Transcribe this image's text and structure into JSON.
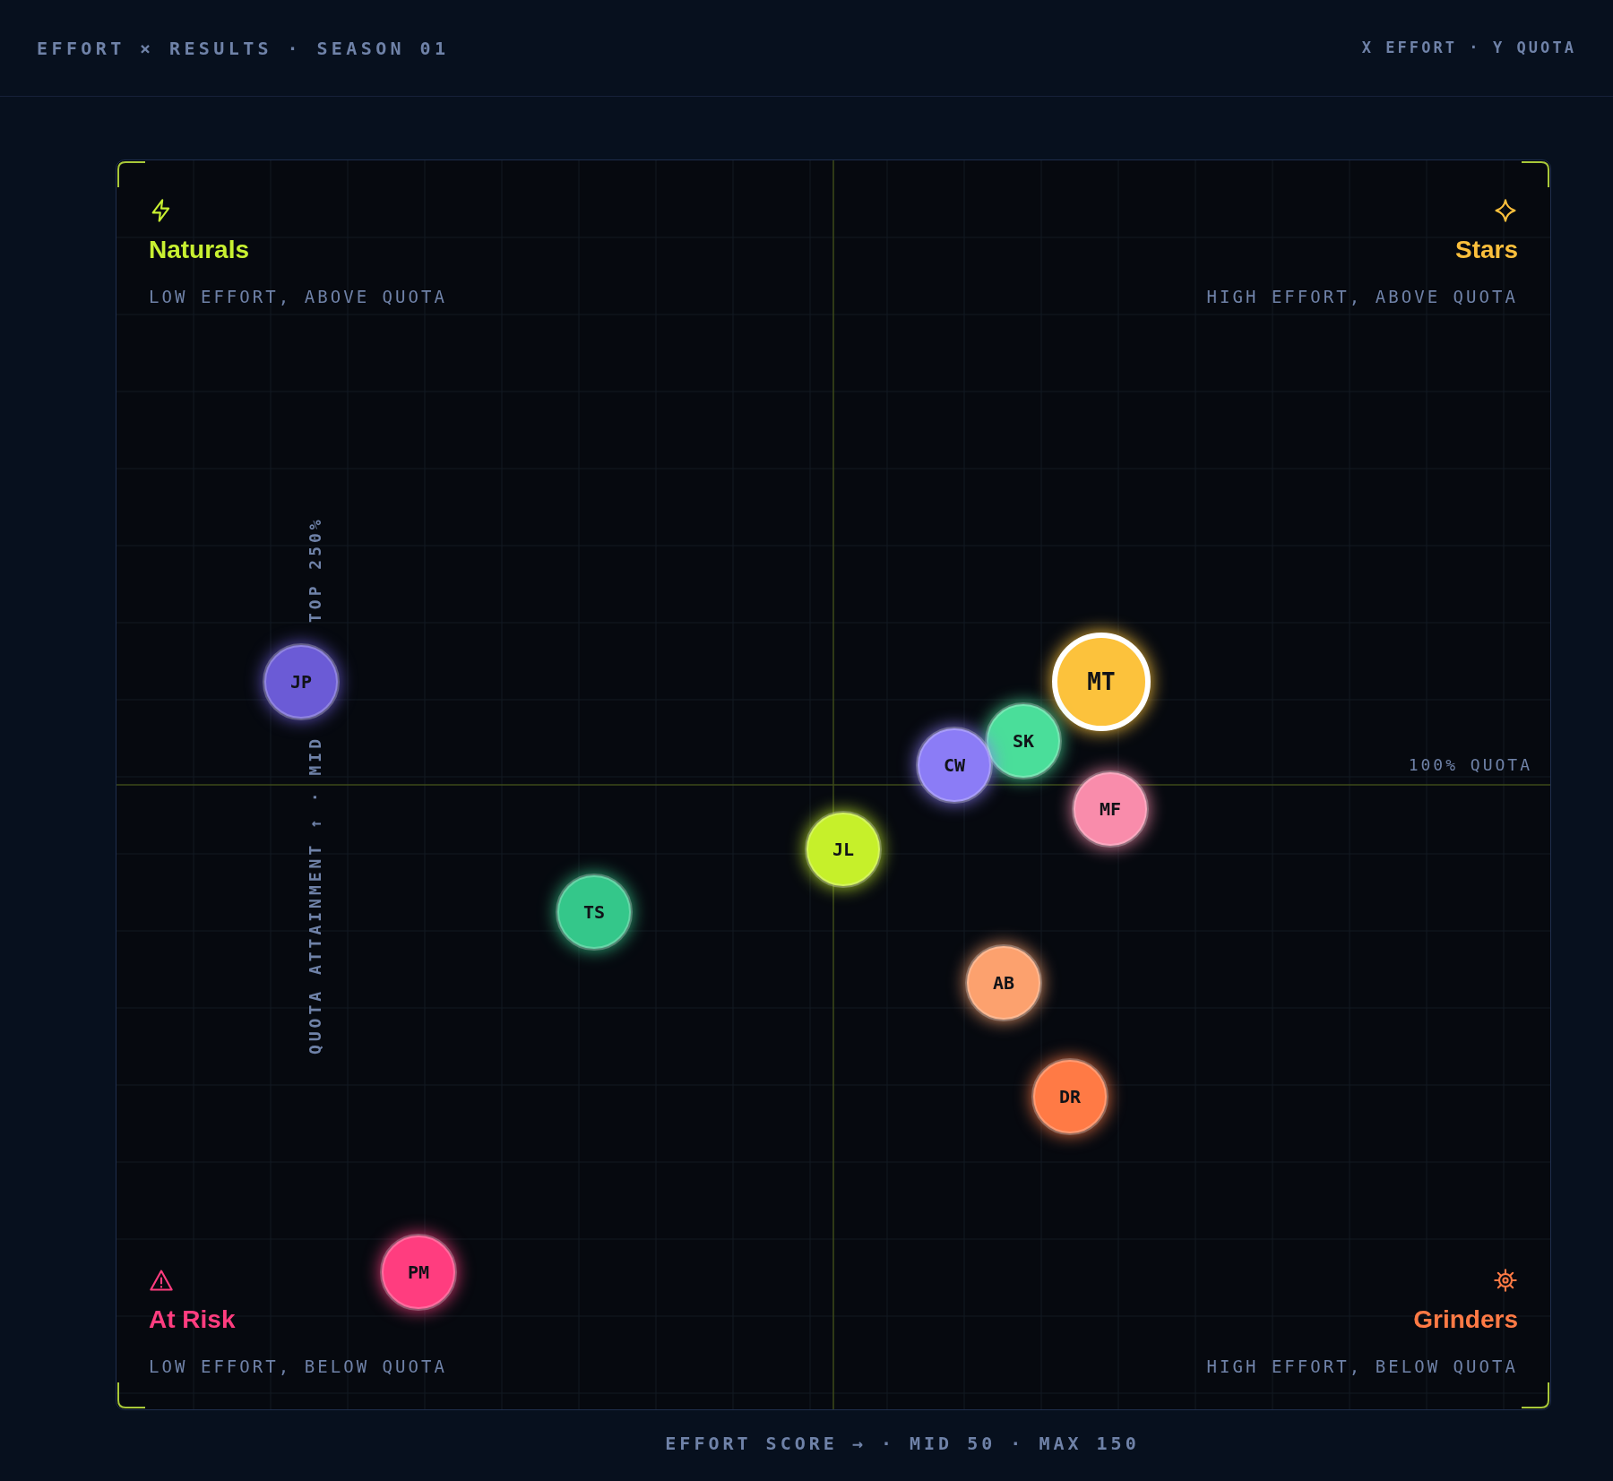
{
  "header": {
    "title": "EFFORT × RESULTS · SEASON 01",
    "legend": "X EFFORT · Y QUOTA"
  },
  "quadrants": [
    {
      "name": "Naturals",
      "description": "LOW EFFORT, ABOVE QUOTA",
      "color": "#c8f031"
    },
    {
      "name": "Stars",
      "description": "HIGH EFFORT, ABOVE QUOTA",
      "color": "#fbbf3c"
    },
    {
      "name": "At Risk",
      "description": "LOW EFFORT, BELOW QUOTA",
      "color": "#ff3d7f"
    },
    {
      "name": "Grinders",
      "description": "HIGH EFFORT, BELOW QUOTA",
      "color": "#ff7a45"
    }
  ],
  "axes": {
    "y_label": [
      "QUOTA ATTAINMENT ↑ · MID",
      "TOP 250%"
    ],
    "quota_line_label": "100% QUOTA",
    "x_label": "EFFORT SCORE → · MID 50 · MAX 150"
  },
  "people": [
    {
      "initials": "JP",
      "color": "#6b5bd6",
      "highlighted": false
    },
    {
      "initials": "MT",
      "color": "#fcc23c",
      "highlighted": true
    },
    {
      "initials": "SK",
      "color": "#4ade9a",
      "highlighted": false
    },
    {
      "initials": "CW",
      "color": "#8b7cf6",
      "highlighted": false
    },
    {
      "initials": "MF",
      "color": "#f98cab",
      "highlighted": false
    },
    {
      "initials": "JL",
      "color": "#c6f02a",
      "highlighted": false
    },
    {
      "initials": "TS",
      "color": "#34c78a",
      "highlighted": false
    },
    {
      "initials": "AB",
      "color": "#fca16e",
      "highlighted": false
    },
    {
      "initials": "DR",
      "color": "#ff7a45",
      "highlighted": false
    },
    {
      "initials": "PM",
      "color": "#ff3d7f",
      "highlighted": false
    }
  ]
}
